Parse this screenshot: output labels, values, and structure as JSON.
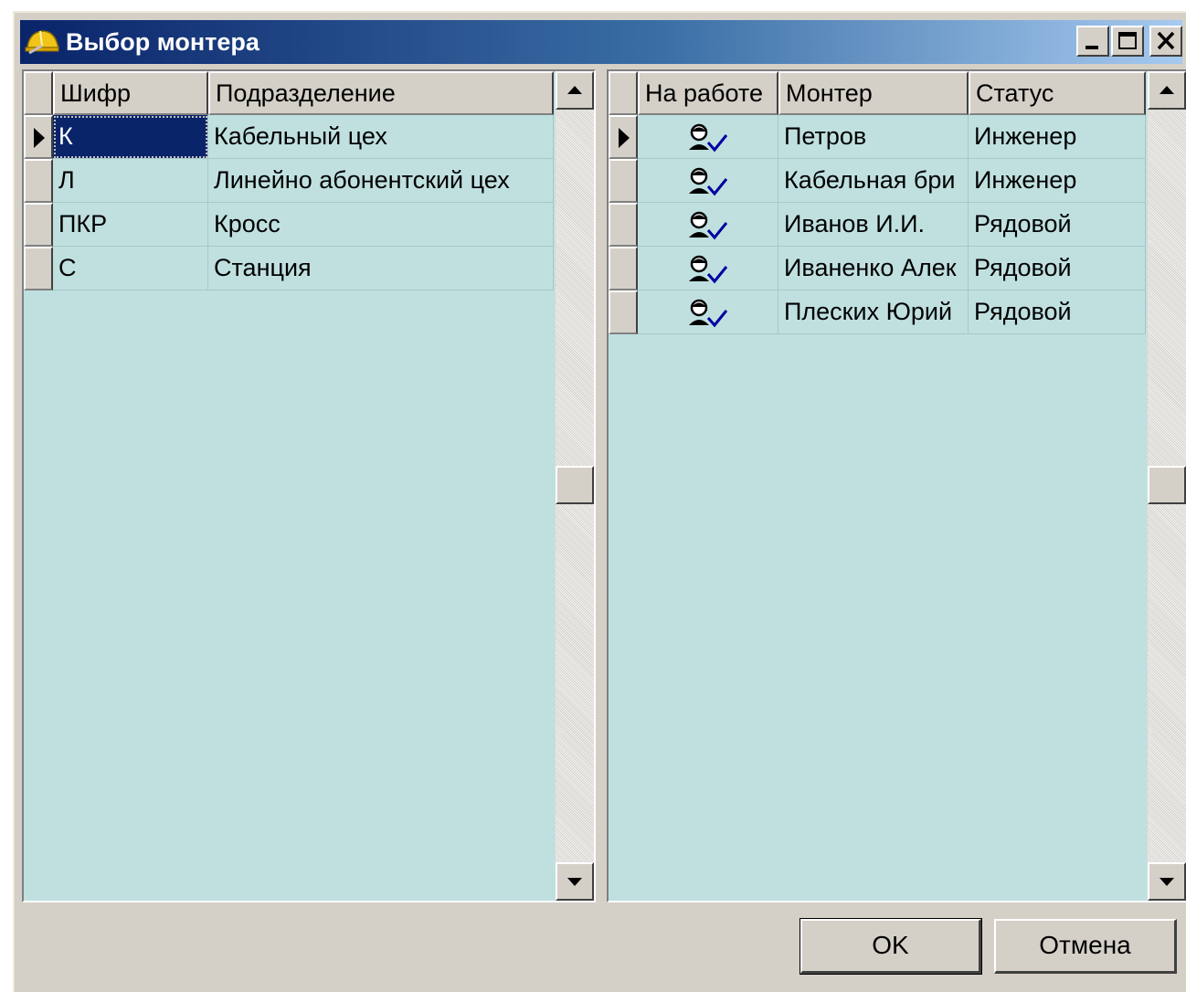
{
  "window": {
    "title": "Выбор монтера",
    "icon": "hard-hat-icon",
    "controls": [
      "minimize-icon",
      "maximize-icon",
      "close-icon"
    ]
  },
  "divisions_grid": {
    "columns": [
      "Шифр",
      "Подразделение"
    ],
    "rows": [
      {
        "code": "К",
        "name": "Кабельный цех",
        "selected": true
      },
      {
        "code": "Л",
        "name": "Линейно абонентский цех",
        "selected": false
      },
      {
        "code": "ПКР",
        "name": "Кросс",
        "selected": false
      },
      {
        "code": "С",
        "name": "Станция",
        "selected": false
      }
    ]
  },
  "installers_grid": {
    "columns": [
      "На работе",
      "Монтер",
      "Статус"
    ],
    "rows": [
      {
        "at_work_icon": "user-check-icon",
        "installer": "Петров",
        "status": "Инженер",
        "current": true
      },
      {
        "at_work_icon": "user-check-icon",
        "installer": "Кабельная бри",
        "status": "Инженер",
        "current": false
      },
      {
        "at_work_icon": "user-check-icon",
        "installer": "Иванов И.И.",
        "status": "Рядовой",
        "current": false
      },
      {
        "at_work_icon": "user-check-icon",
        "installer": "Иваненко Алек",
        "status": "Рядовой",
        "current": false
      },
      {
        "at_work_icon": "user-check-icon",
        "installer": "Плеских Юрий",
        "status": "Рядовой",
        "current": false
      }
    ]
  },
  "buttons": {
    "ok": "OK",
    "cancel": "Отмена"
  }
}
